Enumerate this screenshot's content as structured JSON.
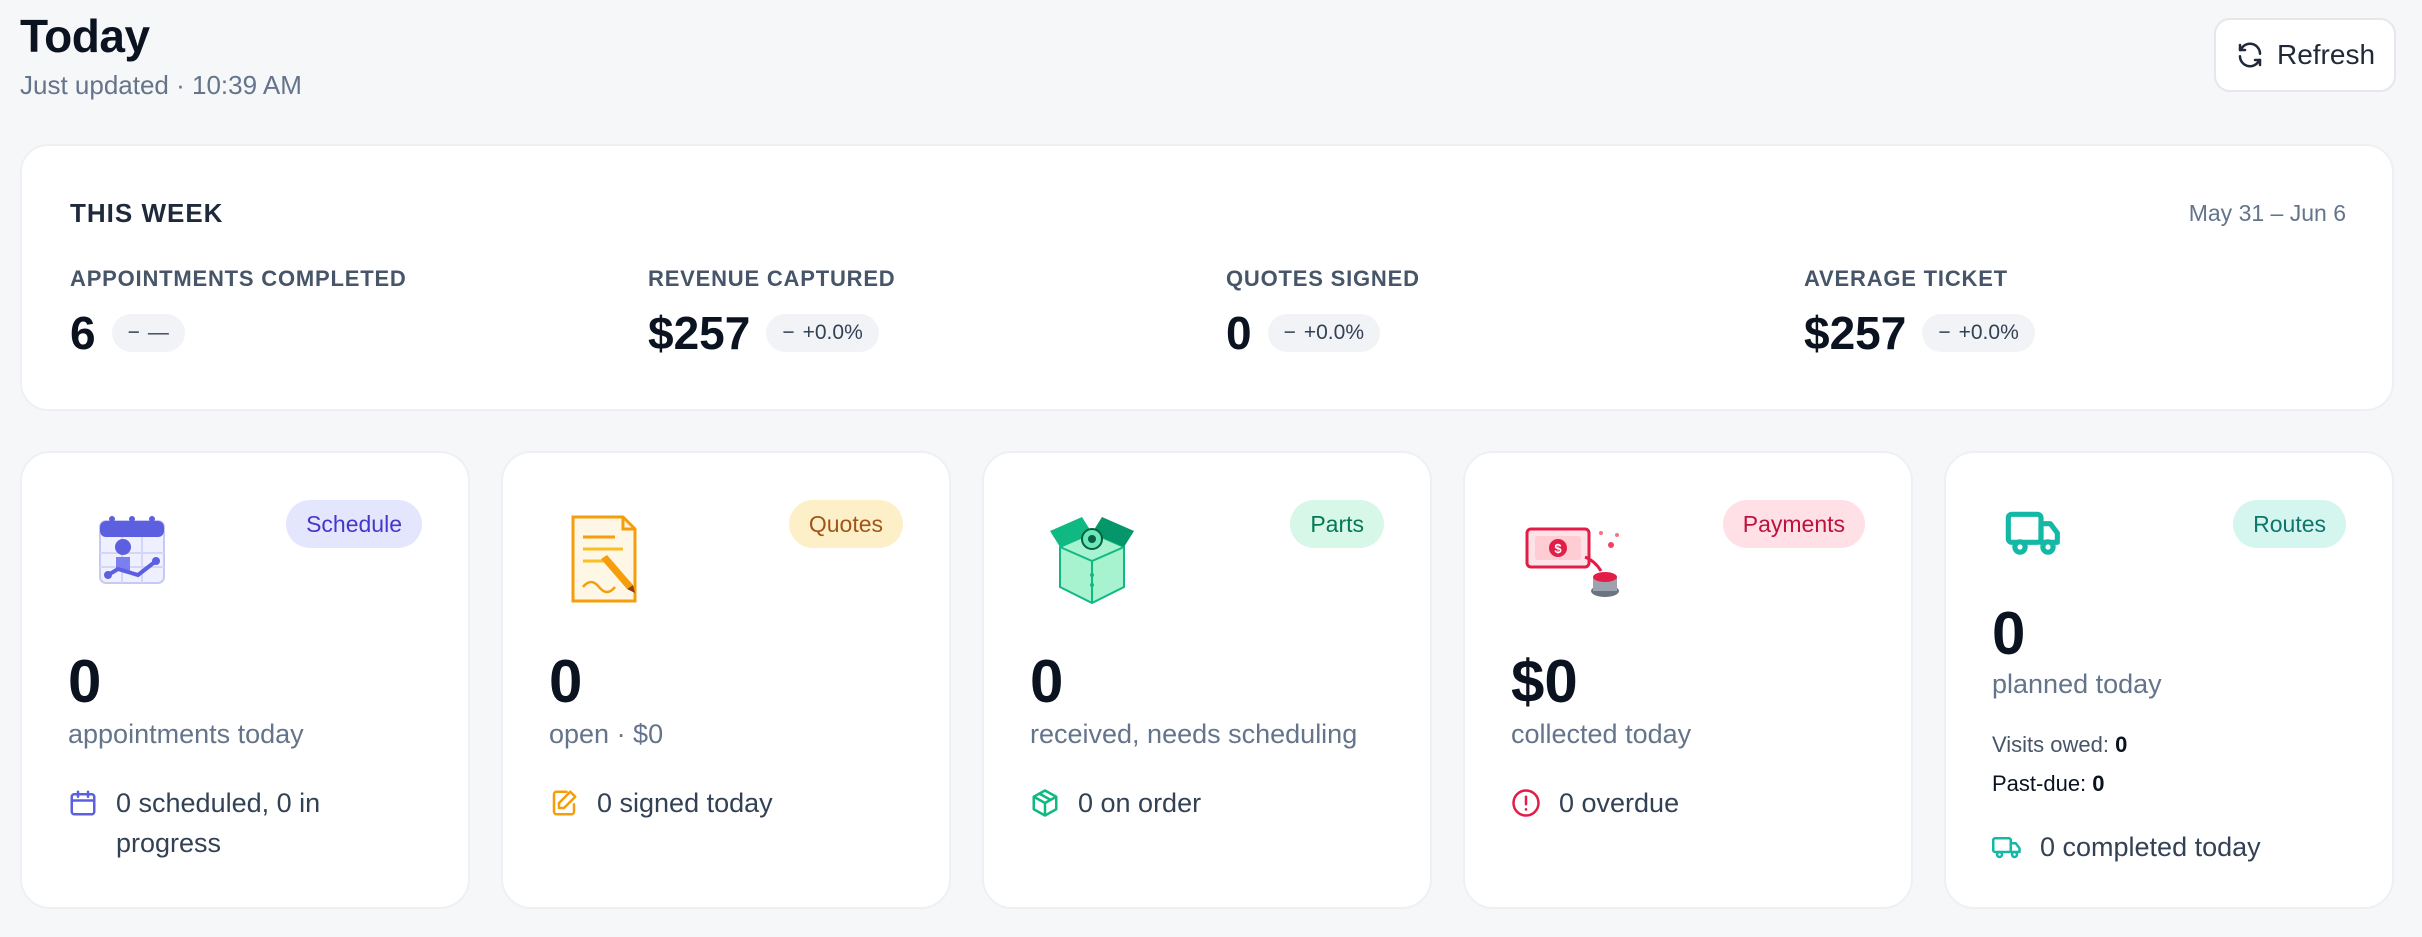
{
  "header": {
    "title": "Today",
    "subtitle": "Just updated · 10:39 AM",
    "refresh_label": "Refresh"
  },
  "week": {
    "title": "THIS WEEK",
    "range": "May 31 – Jun 6",
    "stats": [
      {
        "label": "APPOINTMENTS COMPLETED",
        "value": "6",
        "delta": "—"
      },
      {
        "label": "REVENUE CAPTURED",
        "value": "$257",
        "delta": "+0.0%"
      },
      {
        "label": "QUOTES SIGNED",
        "value": "0",
        "delta": "+0.0%"
      },
      {
        "label": "AVERAGE TICKET",
        "value": "$257",
        "delta": "+0.0%"
      }
    ]
  },
  "cards": {
    "schedule": {
      "badge": "Schedule",
      "value": "0",
      "desc": "appointments today",
      "foot": "0 scheduled, 0 in progress",
      "icon": "calendar-illustration"
    },
    "quotes": {
      "badge": "Quotes",
      "value": "0",
      "desc": "open · $0",
      "foot": "0 signed today",
      "icon": "document-pencil-illustration"
    },
    "parts": {
      "badge": "Parts",
      "value": "0",
      "desc": "received, needs scheduling",
      "foot": "0 on order",
      "icon": "open-box-illustration"
    },
    "payments": {
      "badge": "Payments",
      "value": "$0",
      "desc": "collected today",
      "foot": "0 overdue",
      "icon": "cash-button-illustration"
    },
    "routes": {
      "badge": "Routes",
      "value": "0",
      "desc": "planned today",
      "visits_label": "Visits owed:",
      "visits_value": "0",
      "pastdue_label": "Past-due:",
      "pastdue_value": "0",
      "foot": "0 completed today",
      "icon": "truck-icon"
    }
  },
  "colors": {
    "schedule": "#5b5fe0",
    "quotes": "#f59e0b",
    "parts": "#10b981",
    "payments": "#e11d48",
    "routes": "#14b8a6"
  }
}
